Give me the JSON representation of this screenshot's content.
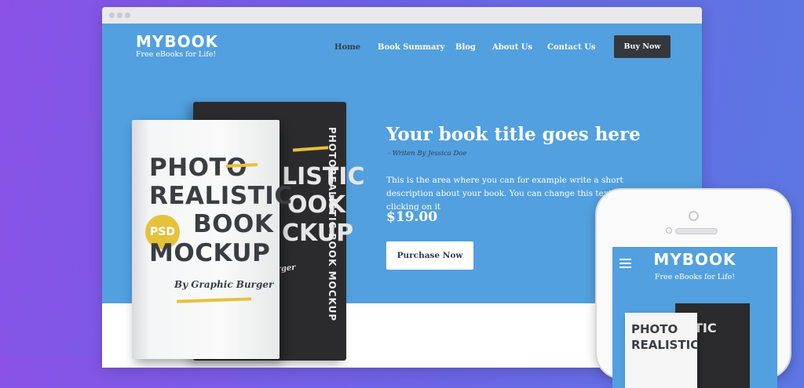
{
  "site": {
    "brand_name": "MYBOOK",
    "tagline": "Free eBooks for Life!",
    "nav": {
      "home": "Home",
      "book_summary": "Book Summary",
      "blog": "Blog",
      "about": "About Us",
      "contact": "Contact Us"
    },
    "buy_button": "Buy Now"
  },
  "hero": {
    "title": "Your book title goes here",
    "author": "- Writen By Jessica Doe",
    "description": "This is the area where you can for example write a short description about your book. You can change this text by clicking on it",
    "price": "$19.00",
    "purchase_button": "Purchase Now"
  },
  "book": {
    "front_line1": "PHOTO",
    "front_line2": "REALISTIC",
    "front_line3": "BOOK",
    "front_line4": "MOCKUP",
    "badge": "PSD",
    "byline": "By Graphic Burger",
    "back_line1": "LISTIC",
    "back_line2": "OOK",
    "back_line3": "CKUP",
    "back_byline": "Burger",
    "spine": "PHOTOREALISTIC BOOK MOCKUP"
  },
  "phone": {
    "brand_name": "MYBOOK",
    "tagline": "Free eBooks for Life!",
    "cover_line1": "PHOTO",
    "cover_line2": "REALISTIC",
    "back_text": "TIC"
  },
  "colors": {
    "background_start": "#8a52e6",
    "background_end": "#5b78e2",
    "site_blue": "#52a0df",
    "button_dark": "#34383d",
    "accent_yellow": "#e6c23c"
  }
}
